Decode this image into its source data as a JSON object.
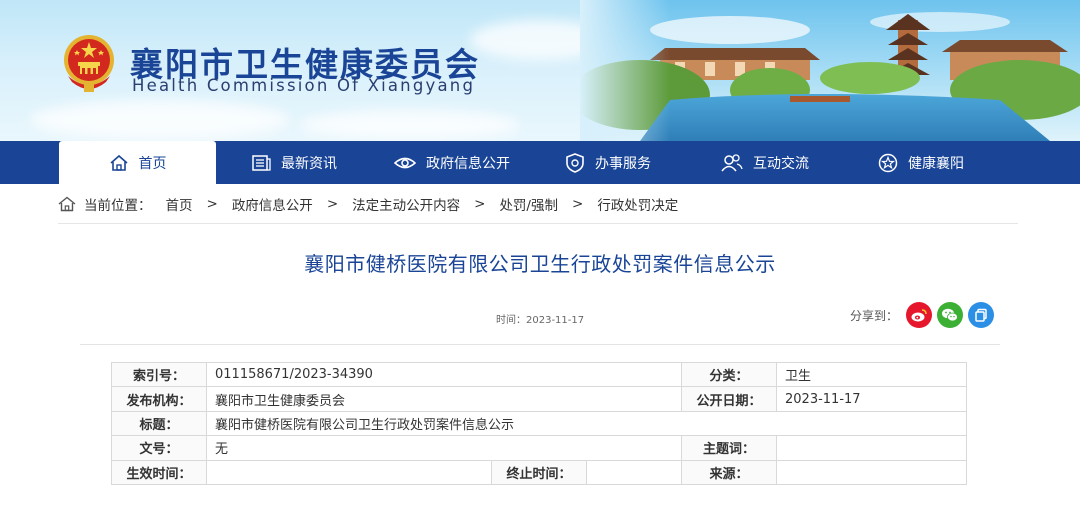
{
  "header": {
    "title": "襄阳市卫生健康委员会",
    "subtitle": "Health Commission Of Xiangyang"
  },
  "nav": {
    "items": [
      {
        "label": "首页",
        "icon": "home-icon"
      },
      {
        "label": "最新资讯",
        "icon": "news-icon"
      },
      {
        "label": "政府信息公开",
        "icon": "eye-icon"
      },
      {
        "label": "办事服务",
        "icon": "shield-icon"
      },
      {
        "label": "互动交流",
        "icon": "users-icon"
      },
      {
        "label": "健康襄阳",
        "icon": "star-icon"
      }
    ],
    "active_color": "#1a4597"
  },
  "breadcrumb": {
    "prefix": "当前位置：",
    "items": [
      "首页",
      "政府信息公开",
      "法定主动公开内容",
      "处罚/强制",
      "行政处罚决定"
    ],
    "separator": ">"
  },
  "article": {
    "title": "襄阳市健桥医院有限公司卫生行政处罚案件信息公示",
    "time_label": "时间：",
    "time": "2023-11-17",
    "share_label": "分享到：",
    "share_icons": [
      "weibo-icon",
      "wechat-icon",
      "copy-icon"
    ]
  },
  "info": {
    "index_label": "索引号：",
    "index_value": "011158671/2023-34390",
    "category_label": "分类：",
    "category_value": "卫生",
    "publisher_label": "发布机构：",
    "publisher_value": "襄阳市卫生健康委员会",
    "pubdate_label": "公开日期：",
    "pubdate_value": "2023-11-17",
    "title_label": "标题：",
    "title_value": "襄阳市健桥医院有限公司卫生行政处罚案件信息公示",
    "docno_label": "文号：",
    "docno_value": "无",
    "keyword_label": "主题词：",
    "keyword_value": "",
    "effective_label": "生效时间：",
    "effective_value": "",
    "expire_label": "终止时间：",
    "expire_value": "",
    "source_label": "来源：",
    "source_value": ""
  },
  "colors": {
    "brand": "#1a4597",
    "weibo": "#e6162d",
    "wechat": "#3cb034",
    "copy": "#2b8fe6"
  }
}
